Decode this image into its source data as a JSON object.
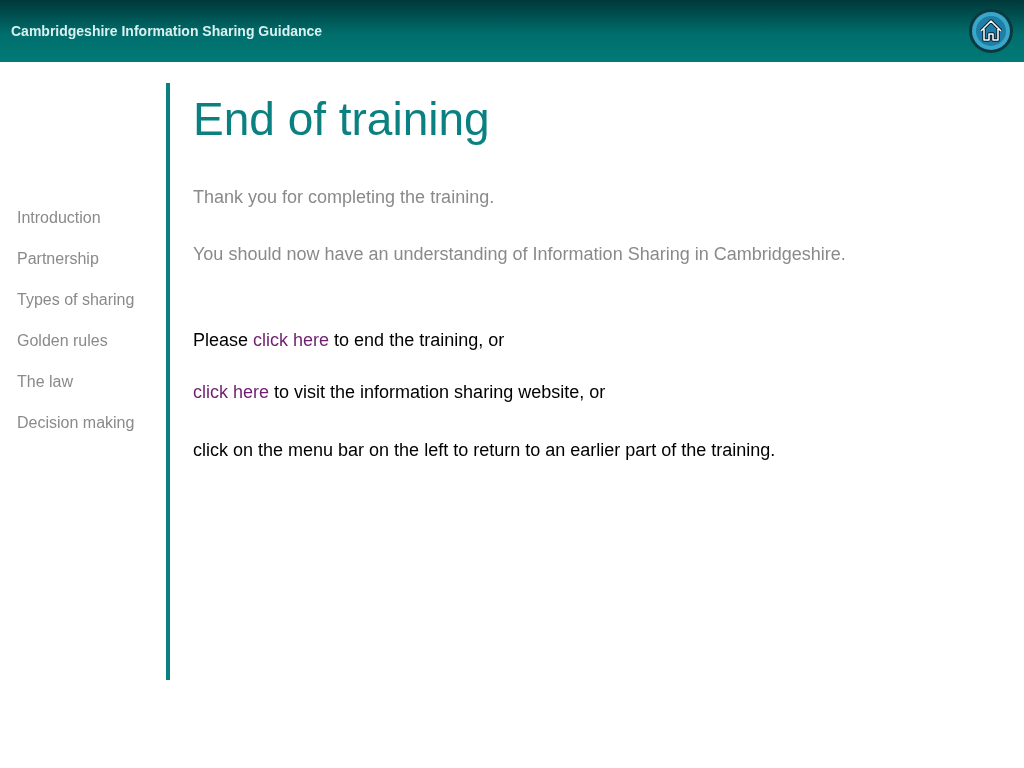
{
  "header": {
    "title": "Cambridgeshire Information Sharing Guidance"
  },
  "sidebar": {
    "items": [
      "Introduction",
      "Partnership",
      "Types of sharing",
      "Golden rules",
      "The law",
      "Decision making"
    ]
  },
  "content": {
    "title": "End of training",
    "intro": [
      "Thank you for completing the training.",
      "You should now have an understanding of Information Sharing in Cambridgeshire."
    ],
    "options": [
      {
        "before": "Please ",
        "link": "click here",
        "after": " to end the training, or"
      },
      {
        "link": "click here",
        "after": " to visit the information sharing website, or"
      },
      {
        "after": "click on the menu bar on the left to return to an earlier part of the training."
      }
    ]
  }
}
